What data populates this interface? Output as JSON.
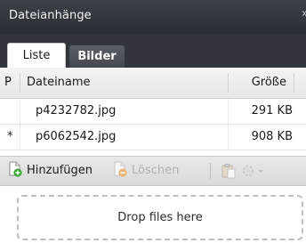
{
  "panel": {
    "title": "Dateianhänge",
    "collapse_glyph": "»"
  },
  "tabs": [
    {
      "label": "Liste",
      "active": true
    },
    {
      "label": "Bilder",
      "active": false
    }
  ],
  "table": {
    "headers": {
      "p": "P",
      "name": "Dateiname",
      "size": "Größe"
    },
    "rows": [
      {
        "p": "",
        "name": "p4232782.jpg",
        "size": "291 KB"
      },
      {
        "p": "*",
        "name": "p6062542.jpg",
        "size": "908 KB"
      }
    ]
  },
  "toolbar": {
    "add_label": "Hinzufügen",
    "delete_label": "Löschen",
    "add_icon": "file-add-icon",
    "delete_icon": "file-delete-icon",
    "paste_icon": "paste-icon",
    "settings_icon": "settings-dropdown-icon"
  },
  "dropzone": {
    "text": "Drop files here"
  },
  "colors": {
    "header_bg": "#2f3338",
    "add_green": "#3aa83a",
    "delete_orange": "#e8a05a"
  }
}
